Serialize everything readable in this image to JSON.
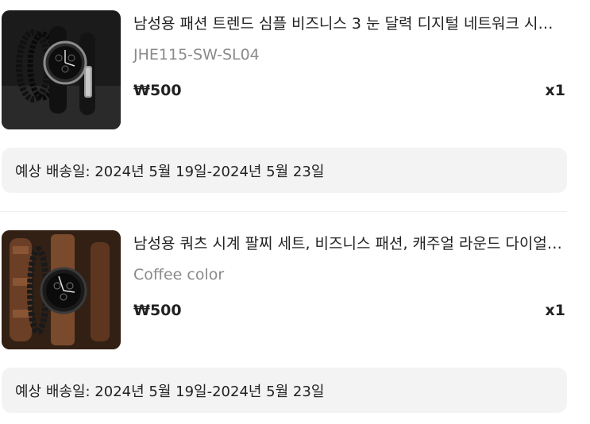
{
  "items": [
    {
      "title": "남성용 패션 트렌드 심플 비즈니스 3 눈 달력 디지털 네트워크 시계 + 손목 팔찌 세트",
      "variant": "JHE115-SW-SL04",
      "price": "₩500",
      "quantity": "x1",
      "delivery": "예상 배송일: 2024년 5월 19일-2024년 5월 23일",
      "image_icon": "watch-bracelet-set-black"
    },
    {
      "title": "남성용 쿼츠 시계 팔찌 세트, 비즈니스 패션, 캐주얼 라운드 다이얼 가죽 스트랩",
      "variant": "Coffee color",
      "price": "₩500",
      "quantity": "x1",
      "delivery": "예상 배송일: 2024년 5월 19일-2024년 5월 23일",
      "image_icon": "watch-bracelet-set-brown"
    }
  ],
  "colors": {
    "text_primary": "#222222",
    "text_secondary": "#8a8a8a",
    "delivery_bg": "#f3f3f3",
    "divider": "#ececec"
  }
}
